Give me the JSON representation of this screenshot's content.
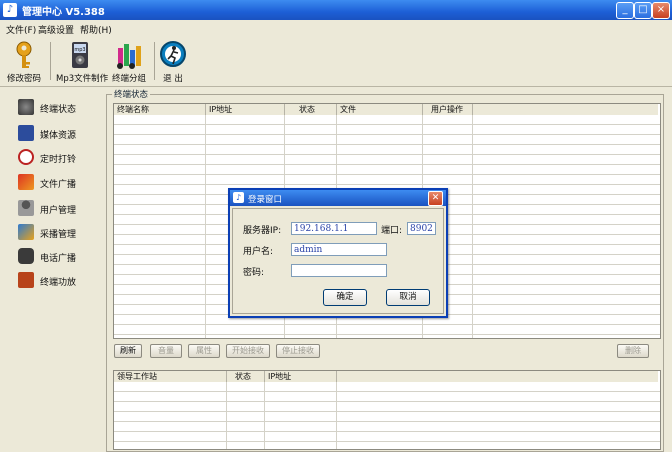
{
  "window": {
    "title": "管理中心 V5.388",
    "min": "_",
    "max": "□",
    "close": "×"
  },
  "menu": [
    "文件(F)",
    "高级设置",
    "帮助(H)"
  ],
  "toolbar": [
    {
      "label": "修改密码",
      "icon": "key-icon"
    },
    {
      "label": "Mp3文件制作",
      "icon": "mp3-icon"
    },
    {
      "label": "终端分组",
      "icon": "group-icon"
    },
    {
      "label": "退  出",
      "icon": "exit-icon"
    }
  ],
  "sidebar": [
    {
      "label": "终端状态",
      "icon": "terminal-icon"
    },
    {
      "label": "媒体资源",
      "icon": "media-icon"
    },
    {
      "label": "定时打铃",
      "icon": "clock-icon"
    },
    {
      "label": "文件广播",
      "icon": "broadcast-icon"
    },
    {
      "label": "用户管理",
      "icon": "user-icon"
    },
    {
      "label": "采播管理",
      "icon": "capture-icon"
    },
    {
      "label": "电话广播",
      "icon": "phone-icon"
    },
    {
      "label": "终端功放",
      "icon": "amplifier-icon"
    }
  ],
  "group_title": "终端状态",
  "terminal_table": {
    "columns": [
      "终端名称",
      "IP地址",
      "状态",
      "文件",
      "用户操作"
    ]
  },
  "actions": {
    "refresh": "刷新",
    "volume": "音量",
    "properties": "属性",
    "start_receive": "开始接收",
    "stop_receive": "停止接收",
    "delete": "删除"
  },
  "workstation_table": {
    "columns": [
      "领导工作站",
      "状态",
      "IP地址"
    ]
  },
  "dialog": {
    "title": "登录窗口",
    "server_ip_label": "服务器IP:",
    "server_ip": "192.168.1.1",
    "port_label": "端口:",
    "port": "8902",
    "username_label": "用户名:",
    "username": "admin",
    "password_label": "密码:",
    "password": "",
    "ok": "确定",
    "cancel": "取消"
  }
}
